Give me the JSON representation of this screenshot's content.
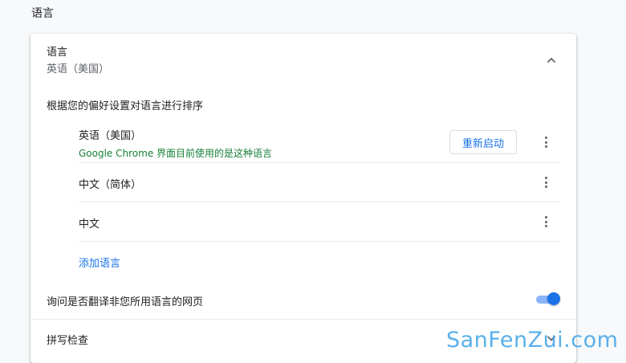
{
  "section": {
    "title": "语言"
  },
  "languages": {
    "header_title": "语言",
    "header_subtitle": "英语（美国）",
    "order_label": "根据您的偏好设置对语言进行排序",
    "items": [
      {
        "name": "英语（美国）",
        "note": "Google Chrome 界面目前使用的是这种语言",
        "action": "重新启动"
      },
      {
        "name": "中文（简体）"
      },
      {
        "name": "中文"
      }
    ],
    "add_language": "添加语言",
    "translate_label": "询问是否翻译非您所用语言的网页",
    "translate_enabled": true
  },
  "spellcheck": {
    "label": "拼写检查"
  },
  "watermark": "SanFenZui.com",
  "colors": {
    "accent": "#1a73e8",
    "note_green": "#188038",
    "watermark": "#49a8e8"
  }
}
